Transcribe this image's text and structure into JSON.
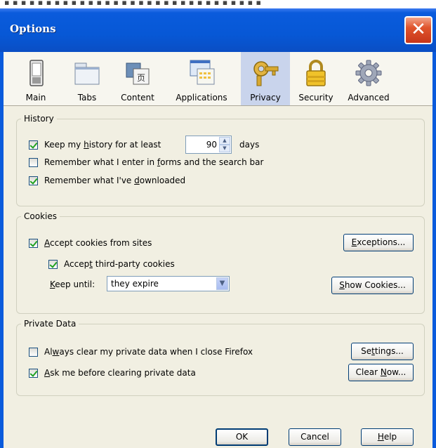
{
  "window": {
    "title": "Options"
  },
  "tabs": [
    {
      "label": "Main",
      "icon": "main-switch-icon"
    },
    {
      "label": "Tabs",
      "icon": "tabs-icon"
    },
    {
      "label": "Content",
      "icon": "content-icon"
    },
    {
      "label": "Applications",
      "icon": "applications-icon"
    },
    {
      "label": "Privacy",
      "icon": "privacy-key-icon",
      "selected": true
    },
    {
      "label": "Security",
      "icon": "security-lock-icon"
    },
    {
      "label": "Advanced",
      "icon": "advanced-gear-icon"
    }
  ],
  "history": {
    "legend": "History",
    "keep_history": {
      "checked": true,
      "pre": "Keep my ",
      "mn": "h",
      "post": "istory for at least"
    },
    "days_value": "90",
    "days_label": "days",
    "remember_forms": {
      "checked": false,
      "pre": "Remember what I enter in ",
      "mn": "f",
      "post": "orms and the search bar"
    },
    "remember_downloads": {
      "checked": true,
      "pre": "Remember what I've ",
      "mn": "d",
      "post": "ownloaded"
    }
  },
  "cookies": {
    "legend": "Cookies",
    "accept_cookies": {
      "checked": true,
      "pre": "",
      "mn": "A",
      "post": "ccept cookies from sites"
    },
    "accept_third_party": {
      "checked": true,
      "pre": "Accep",
      "mn": "t",
      "post": " third-party cookies"
    },
    "keep_until": {
      "pre": "",
      "mn": "K",
      "post": "eep until:"
    },
    "keep_until_value": "they expire",
    "exceptions_button": {
      "pre": "",
      "mn": "E",
      "post": "xceptions..."
    },
    "show_cookies_button": {
      "pre": "",
      "mn": "S",
      "post": "how Cookies..."
    }
  },
  "private_data": {
    "legend": "Private Data",
    "always_clear": {
      "checked": false,
      "pre": "Al",
      "mn": "w",
      "post": "ays clear my private data when I close Firefox"
    },
    "ask_before": {
      "checked": true,
      "pre": "",
      "mn": "A",
      "post": "sk me before clearing private data"
    },
    "settings_button": {
      "pre": "Se",
      "mn": "t",
      "post": "tings..."
    },
    "clear_now_button": {
      "pre": "Clear ",
      "mn": "N",
      "post": "ow..."
    }
  },
  "footer": {
    "ok_label": "OK",
    "cancel_label": "Cancel",
    "help_button": {
      "pre": "",
      "mn": "H",
      "post": "elp"
    }
  },
  "colors": {
    "titlebar": "#0758d6",
    "client_bg": "#f1efe2",
    "selected_tab_bg": "#c9d4ec",
    "check_green": "#21a121"
  }
}
